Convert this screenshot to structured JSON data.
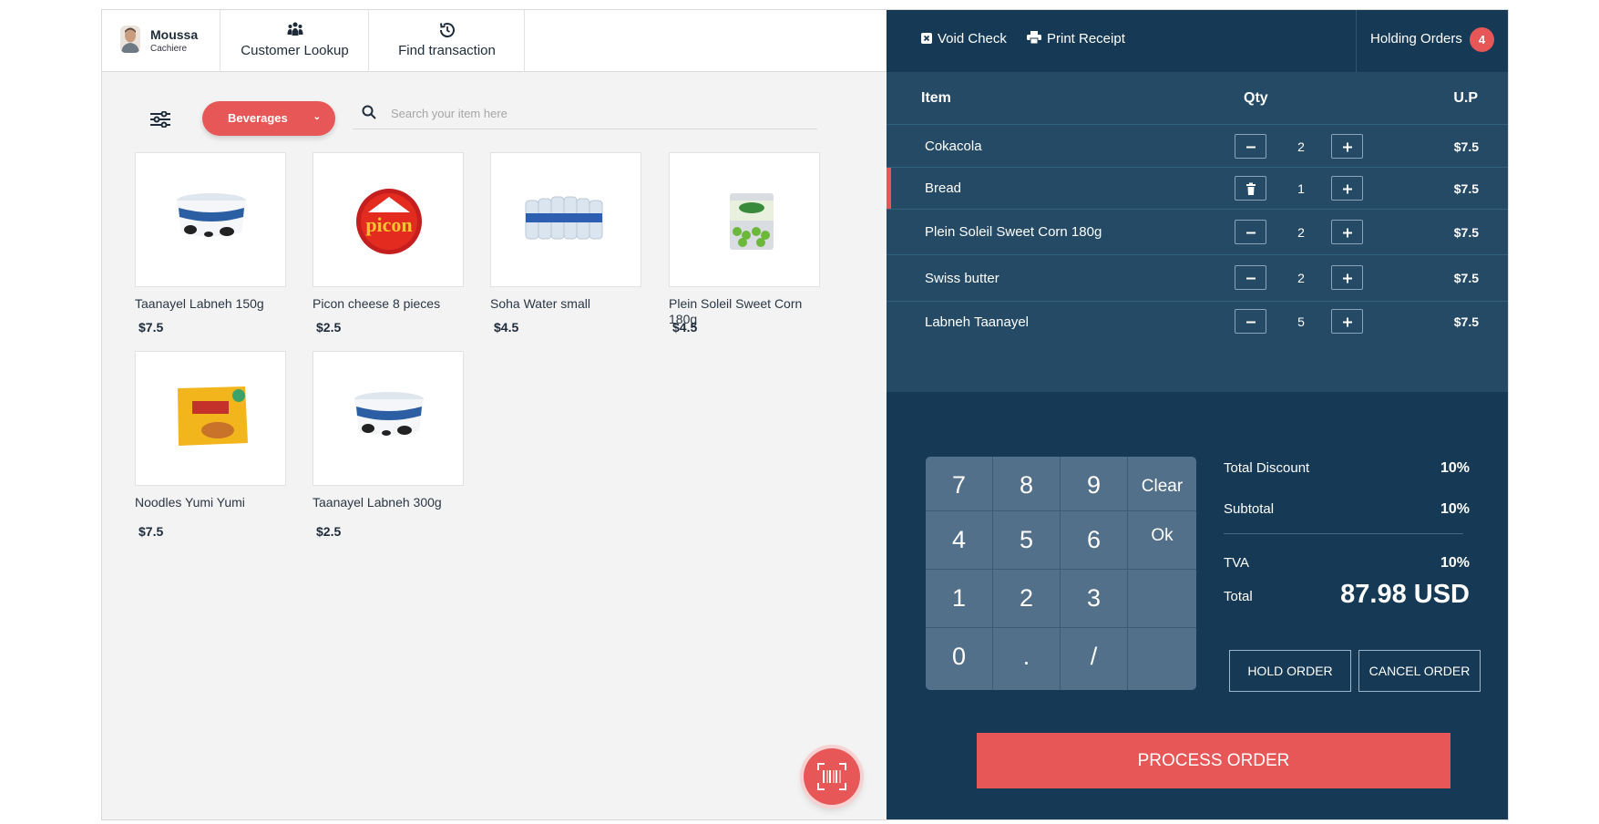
{
  "user": {
    "name": "Moussa",
    "role": "Cachiere"
  },
  "nav": {
    "customer_lookup": "Customer Lookup",
    "find_transaction": "Find transaction"
  },
  "category": {
    "selected": "Beverages"
  },
  "search": {
    "placeholder": "Search your item here"
  },
  "products": [
    {
      "name": "Taanayel Labneh 150g",
      "price": "$7.5",
      "icon": "labneh-tub-image"
    },
    {
      "name": "Picon cheese 8 pieces",
      "price": "$2.5",
      "icon": "picon-cheese-image"
    },
    {
      "name": "Soha Water small",
      "price": "$4.5",
      "icon": "water-bottles-image"
    },
    {
      "name": "Plein Soleil Sweet Corn 180g",
      "price": "$4.5",
      "icon": "peas-can-image"
    },
    {
      "name": "Noodles Yumi Yumi",
      "price": "$7.5",
      "icon": "noodles-pack-image"
    },
    {
      "name": "Taanayel Labneh 300g",
      "price": "$2.5",
      "icon": "labneh-tub-image"
    }
  ],
  "actions": {
    "void_check": "Void Check",
    "print_receipt": "Print Receipt",
    "holding_orders": "Holding Orders",
    "holding_count": "4"
  },
  "order": {
    "headers": {
      "item": "Item",
      "qty": "Qty",
      "unit_price": "U.P"
    },
    "items": [
      {
        "name": "Cokacola",
        "qty": "2",
        "price": "$7.5"
      },
      {
        "name": "Bread",
        "qty": "1",
        "price": "$7.5"
      },
      {
        "name": "Plein Soleil Sweet Corn 180g",
        "qty": "2",
        "price": "$7.5"
      },
      {
        "name": "Swiss butter",
        "qty": "2",
        "price": "$7.5"
      },
      {
        "name": "Labneh Taanayel",
        "qty": "5",
        "price": "$7.5"
      }
    ]
  },
  "keypad": [
    "7",
    "8",
    "9",
    "Clear",
    "4",
    "5",
    "6",
    "Ok",
    "1",
    "2",
    "3",
    "",
    "0",
    ".",
    "/",
    ""
  ],
  "totals": {
    "discount_label": "Total Discount",
    "discount": "10%",
    "subtotal_label": "Subtotal",
    "subtotal": "10%",
    "tva_label": "TVA",
    "tva": "10%",
    "total_label": "Total",
    "total": "87.98 USD"
  },
  "buttons": {
    "hold": "HOLD ORDER",
    "cancel": "CANCEL ORDER",
    "process": "PROCESS ORDER"
  },
  "colors": {
    "accent": "#e85757",
    "panel_dark": "#163a55",
    "panel_mid": "#244a66",
    "keypad": "#53708a"
  }
}
